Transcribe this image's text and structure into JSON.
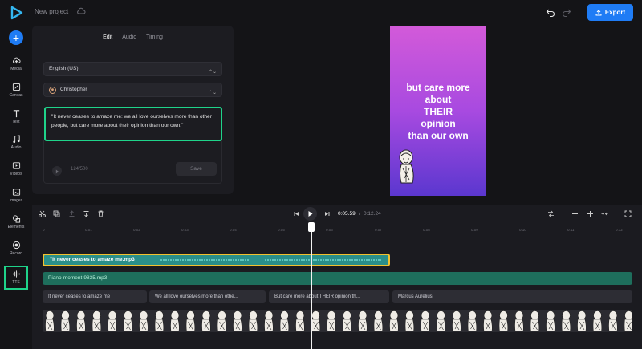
{
  "app": {
    "project_title": "New project",
    "export_label": "Export"
  },
  "sidebar": {
    "add_label": "+",
    "items": [
      {
        "label": "Media",
        "icon": "cloud-upload-icon"
      },
      {
        "label": "Canvas",
        "icon": "canvas-icon"
      },
      {
        "label": "Text",
        "icon": "text-icon"
      },
      {
        "label": "Audio",
        "icon": "music-note-icon"
      },
      {
        "label": "Videos",
        "icon": "video-icon"
      },
      {
        "label": "Images",
        "icon": "image-icon"
      },
      {
        "label": "Elements",
        "icon": "shapes-icon"
      },
      {
        "label": "Record",
        "icon": "record-icon"
      },
      {
        "label": "TTS",
        "icon": "tts-icon"
      }
    ]
  },
  "panel": {
    "tabs": [
      "Edit",
      "Audio",
      "Timing"
    ],
    "active_tab": "Edit",
    "language": "English (US)",
    "voice": "Christopher",
    "text": "\"It never ceases to amaze me: we all love ourselves more than other people, but care more about their opinion than our own.\"",
    "counter": "124/500",
    "save_label": "Save"
  },
  "preview": {
    "line1": "but care more",
    "line2": "about",
    "line3": "THEIR",
    "line4": "opinion",
    "line5": "than our own",
    "gradient_top": "#d35ad9",
    "gradient_bottom": "#5b37cf"
  },
  "timeline": {
    "current_time": "0:05.59",
    "separator": "/",
    "total_time": "0:12.24",
    "ruler": [
      "0",
      "0:01",
      "0:02",
      "0:03",
      "0:04",
      "0:05",
      "0:06",
      "0:07",
      "0:08",
      "0:09",
      "0:10",
      "0:11",
      "0:12"
    ],
    "tts_clip": "\"It never ceases to amaze me.mp3",
    "music_clip": "Piano-moment-9835.mp3",
    "text_clips": [
      "It never ceases to amaze me",
      "We all love ourselves more than othe...",
      "But care more about THEIR opinion th...",
      "Marcus Aurelius"
    ]
  },
  "colors": {
    "accent": "#1f7cf5",
    "highlight": "#1fd38a",
    "clip_border": "#f2c12e"
  }
}
